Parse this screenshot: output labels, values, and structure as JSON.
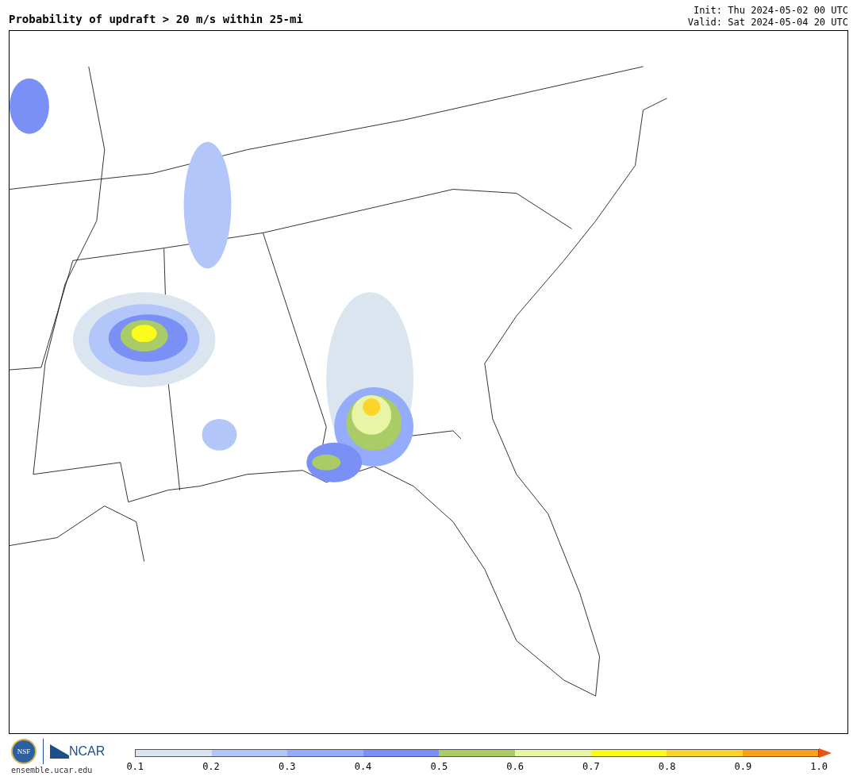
{
  "title": "Probability of updraft > 20 m/s within 25-mi",
  "init": "Init: Thu 2024-05-02 00 UTC",
  "valid": "Valid: Sat 2024-05-04 20 UTC",
  "logos": {
    "nsf": "NSF",
    "ncar": "NCAR",
    "site": "ensemble.ucar.edu"
  },
  "colorbar": {
    "bins": [
      {
        "color": "#dbe5ef"
      },
      {
        "color": "#b3c6fa"
      },
      {
        "color": "#94acfb"
      },
      {
        "color": "#7b90f7"
      },
      {
        "color": "#a9cc66"
      },
      {
        "color": "#e8f5a6"
      },
      {
        "color": "#fcfc1c"
      },
      {
        "color": "#fcd42c"
      },
      {
        "color": "#fba01a"
      }
    ],
    "extend_arrow": {
      "color": "#ea5513"
    },
    "ticks": [
      "0.1",
      "0.2",
      "0.3",
      "0.4",
      "0.5",
      "0.6",
      "0.7",
      "0.8",
      "0.9",
      "1.0"
    ]
  }
}
